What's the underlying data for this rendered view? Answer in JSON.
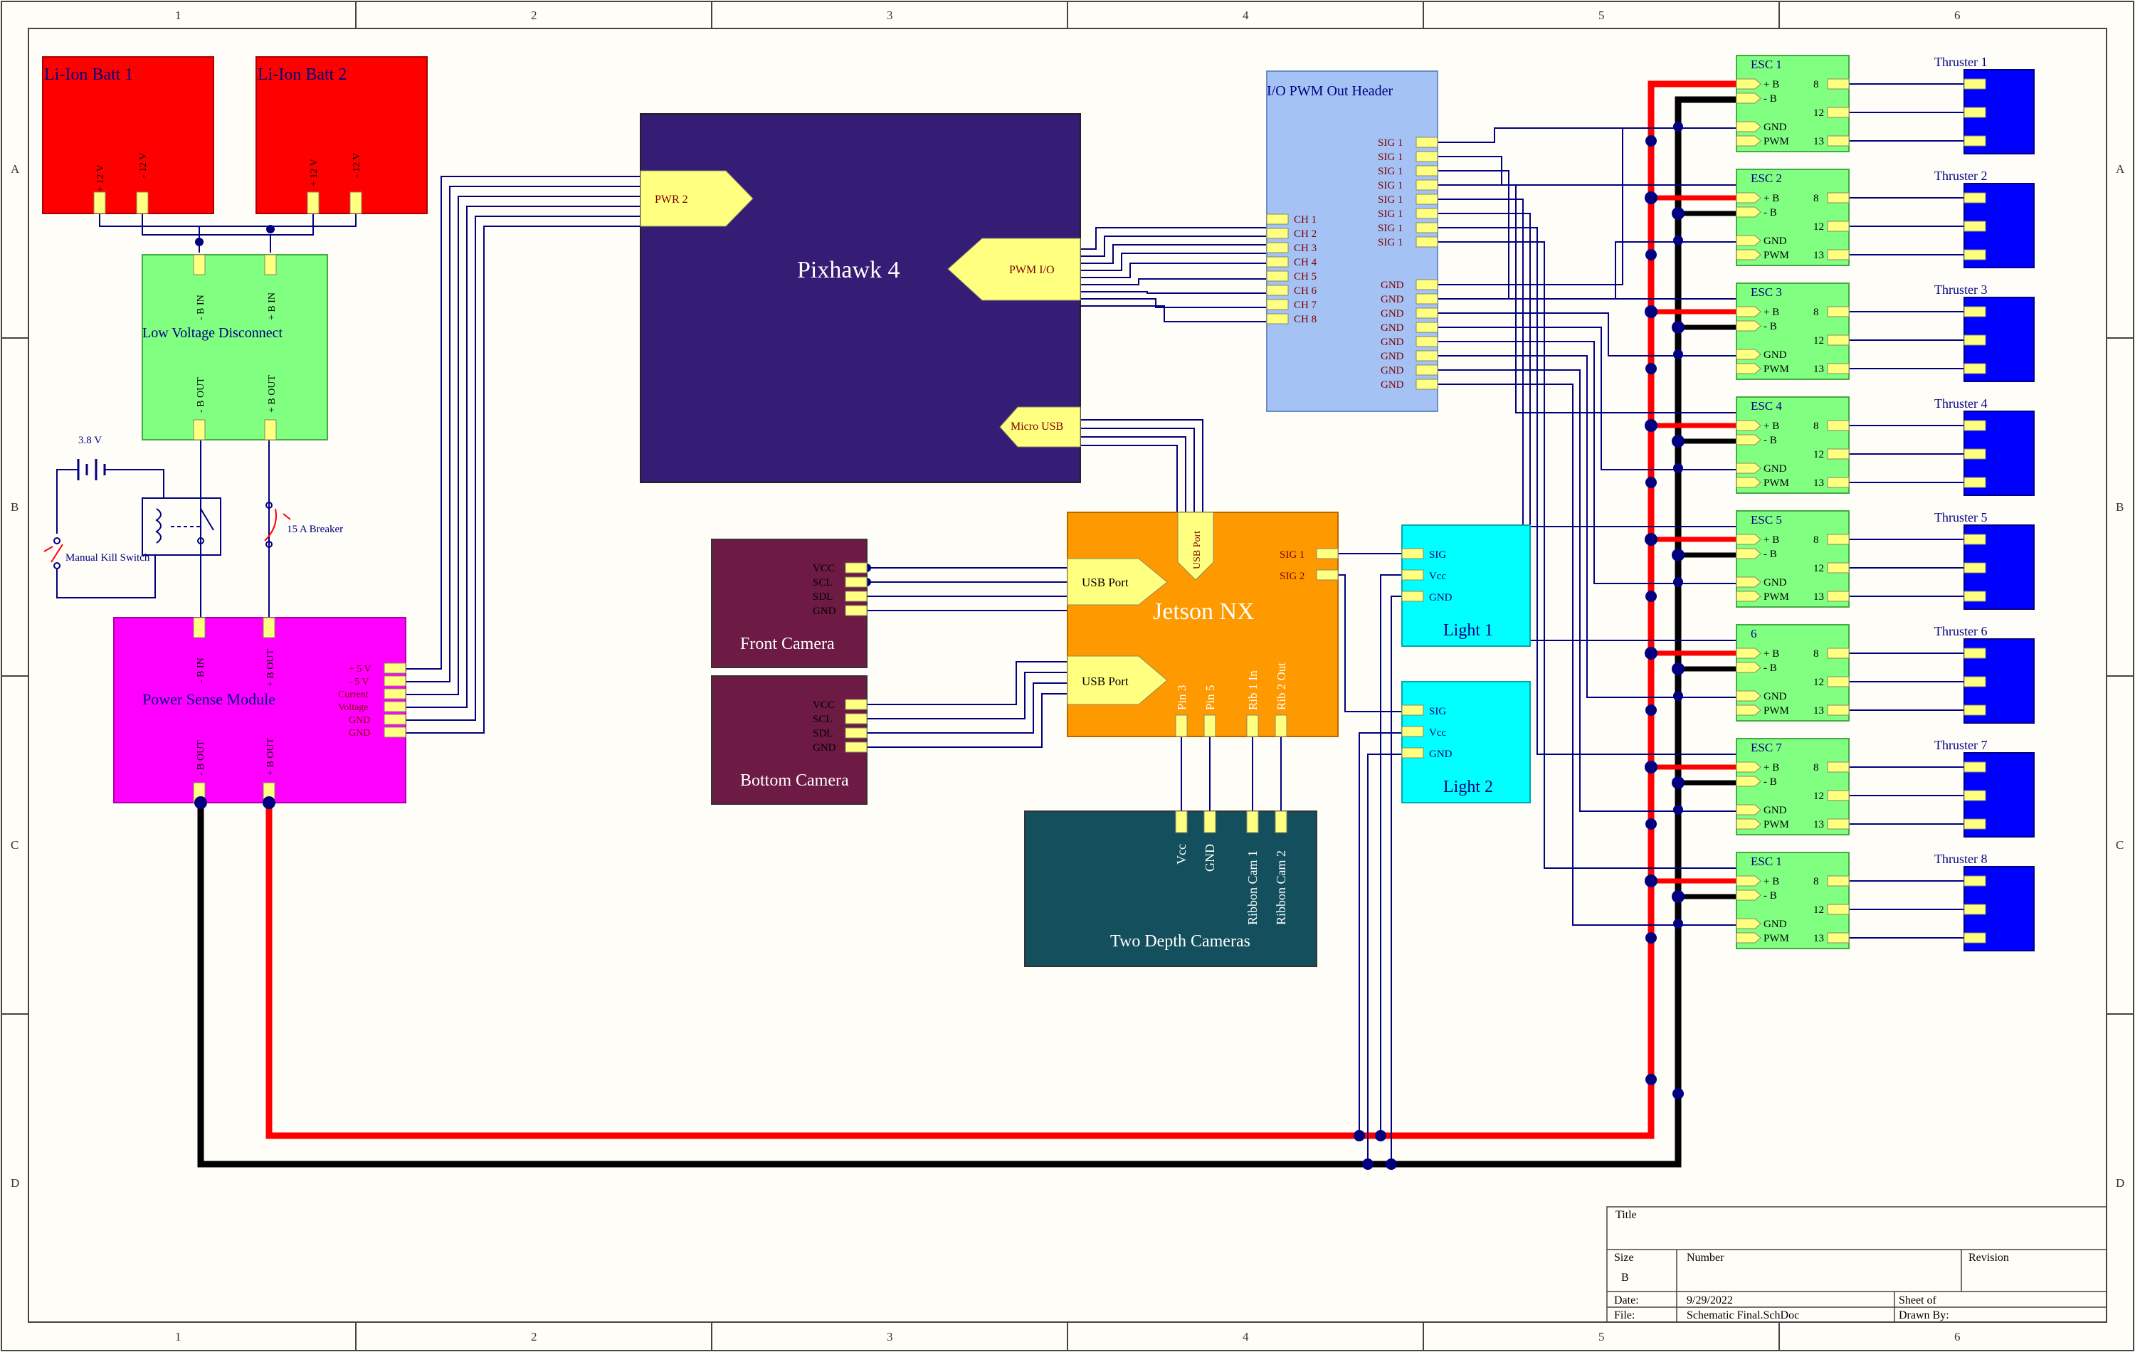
{
  "frame": {
    "columns": [
      "1",
      "2",
      "3",
      "4",
      "5",
      "6"
    ],
    "rows": [
      "A",
      "B",
      "C",
      "D"
    ]
  },
  "batteries": [
    {
      "title": "Li-Ion Batt 1",
      "pins": [
        "+ 12 V",
        "- 12 V"
      ]
    },
    {
      "title": "Li-Ion Batt 2",
      "pins": [
        "+ 12 V",
        "- 12 V"
      ]
    }
  ],
  "lvd": {
    "title": "Low Voltage Disconnect",
    "pins_in": [
      "- B IN",
      "+ B IN"
    ],
    "pins_out": [
      "- B OUT",
      "+ B OUT"
    ]
  },
  "relay": {
    "battery_label": "3.8 V",
    "switch_label": "Manual Kill Switch",
    "breaker_label": "15 A Breaker"
  },
  "psm": {
    "title": "Power Sense Module",
    "pins_top": [
      "- B IN",
      "+ B OUT"
    ],
    "pins_bottom": [
      "- B OUT",
      "+ B OUT"
    ],
    "pins_right": [
      "+ 5 V",
      "- 5 V",
      "Current",
      "Voltage",
      "GND",
      "GND"
    ]
  },
  "pixhawk": {
    "title": "Pixhawk 4",
    "ports": [
      "PWR 2",
      "PWM I/O",
      "Micro USB"
    ]
  },
  "io_header": {
    "title": "I/O PWM Out Header",
    "ch": [
      "CH 1",
      "CH 2",
      "CH 3",
      "CH 4",
      "CH 5",
      "CH 6",
      "CH 7",
      "CH 8"
    ],
    "sig": [
      "SIG 1",
      "SIG 1",
      "SIG 1",
      "SIG 1",
      "SIG 1",
      "SIG 1",
      "SIG 1",
      "SIG 1"
    ],
    "gnd": [
      "GND",
      "GND",
      "GND",
      "GND",
      "GND",
      "GND",
      "GND",
      "GND"
    ]
  },
  "jetson": {
    "title": "Jetson NX",
    "usb_ports": [
      "USB Port",
      "USB Port"
    ],
    "usb_top": "USB Port",
    "sig": [
      "SIG 1",
      "SIG 2"
    ],
    "bottom_pins": [
      "Pin 3",
      "Pin 5",
      "Rib 1 In",
      "Rib 2 Out"
    ]
  },
  "cameras": [
    {
      "title": "Front Camera",
      "pins": [
        "VCC",
        "SCL",
        "SDL",
        "GND"
      ]
    },
    {
      "title": "Bottom Camera",
      "pins": [
        "VCC",
        "SCL",
        "SDL",
        "GND"
      ]
    }
  ],
  "depth": {
    "title": "Two Depth Cameras",
    "pins": [
      "Vcc",
      "GND",
      "Ribbon Cam 1",
      "Ribbon Cam 2"
    ]
  },
  "lights": [
    {
      "title": "Light 1",
      "pins": [
        "SIG",
        "Vcc",
        "GND"
      ]
    },
    {
      "title": "Light 2",
      "pins": [
        "SIG",
        "Vcc",
        "GND"
      ]
    }
  ],
  "escs": [
    {
      "title": "ESC 1",
      "thruster": "Thruster 1"
    },
    {
      "title": "ESC 2",
      "thruster": "Thruster 2"
    },
    {
      "title": "ESC 3",
      "thruster": "Thruster 3"
    },
    {
      "title": "ESC 4",
      "thruster": "Thruster 4"
    },
    {
      "title": "ESC 5",
      "thruster": "Thruster 5"
    },
    {
      "title": "6",
      "thruster": "Thruster 6"
    },
    {
      "title": "ESC 7",
      "thruster": "Thruster 7"
    },
    {
      "title": "ESC 1",
      "thruster": "Thruster 8"
    }
  ],
  "esc_pins_left": [
    "+ B",
    "- B",
    "GND",
    "PWM"
  ],
  "esc_pins_right": [
    "8",
    "12",
    "13"
  ],
  "title_block": {
    "title": "Title",
    "size": "Size",
    "size_value": "B",
    "number": "Number",
    "revision": "Revision",
    "date": "Date:",
    "date_value": "9/29/2022",
    "file": "File:",
    "file_value": "Schematic Final.SchDoc",
    "sheet": "Sheet    of",
    "drawn_by": "Drawn By:"
  },
  "colors": {
    "battery": "#ff0000",
    "lvd": "#80ff80",
    "psm": "#ff00ff",
    "pixhawk": "#351c75",
    "io_header": "#a4c2f4",
    "jetson": "#ff9900",
    "camera": "#6d1b44",
    "depth": "#134f5c",
    "light": "#00ffff",
    "esc": "#80ff80",
    "thruster": "#0000ff",
    "wire": "#000080",
    "pos_rail": "#ff0000",
    "neg_rail": "#000000",
    "pin": "#ffff80"
  }
}
